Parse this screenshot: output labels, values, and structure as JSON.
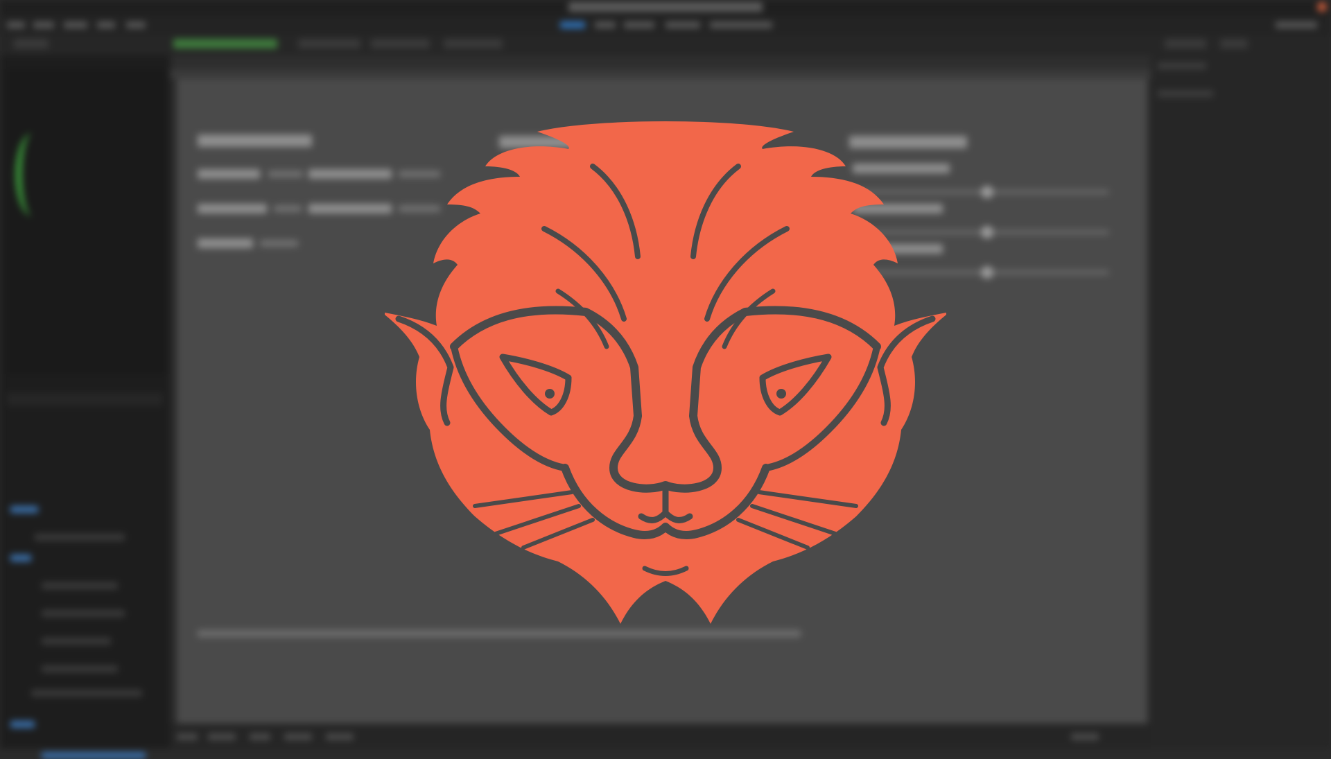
{
  "colors": {
    "logo": "#F2674A",
    "logo_lines": "#4A4A4A",
    "background_dark": "#2b2b2b",
    "canvas": "#4a4a4a",
    "accent_green": "#3b9a3b",
    "accent_blue": "#3a6ea8"
  },
  "logo": {
    "icon": "lion-head-logo"
  },
  "editor": {
    "blurred": true
  }
}
